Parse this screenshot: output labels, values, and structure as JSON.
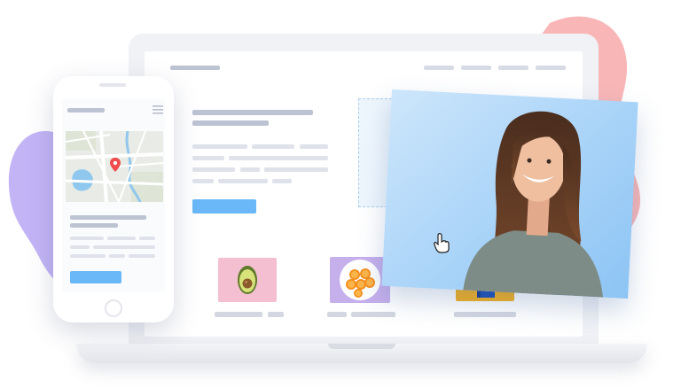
{
  "scene": {
    "colors": {
      "purple_blob": "#b9a7f4",
      "pink_blob": "#f6a7a8",
      "placeholder_bar": "#c5cbd9",
      "placeholder_bar_dark": "#b3bac9",
      "cta_blue": "#6ab8f7",
      "photo_blue": "#a8d3f8",
      "avocado_tile": "#f4bfd0",
      "orange_tile": "#c6b0ec",
      "book_tile": "#f4b020"
    },
    "icons": {
      "hamburger": "hamburger-menu-icon",
      "pin": "map-pin-icon",
      "cursor": "hand-cursor-icon"
    }
  }
}
